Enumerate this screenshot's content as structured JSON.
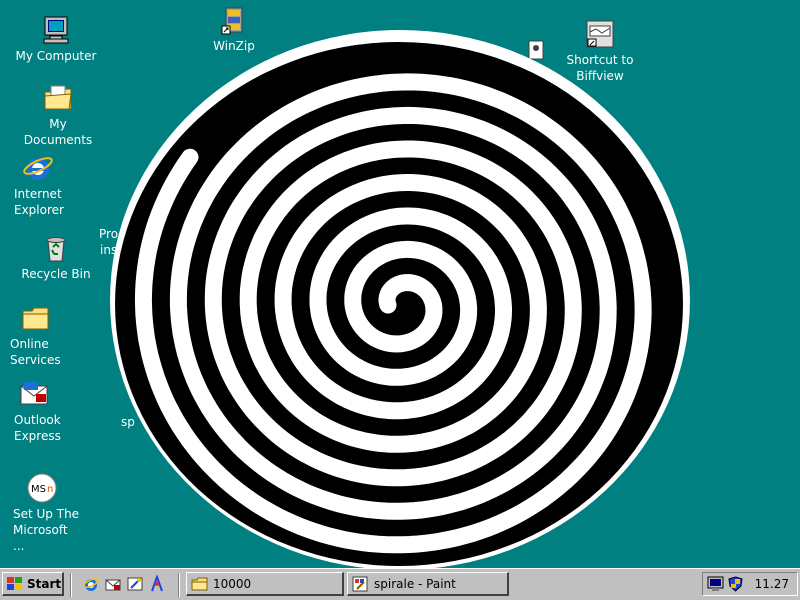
{
  "desktop": {
    "icons": {
      "my_computer": "My Computer",
      "my_documents": "My Documents",
      "internet_explorer": "Internet\nExplorer",
      "recycle_bin": "Recycle Bin",
      "online_services": "Online\nServices",
      "outlook_express": "Outlook\nExpress",
      "setup_msn": "Set Up The\nMicrosoft ...",
      "winzip": "WinZip",
      "shortcut_biffview": "Shortcut to\nBiffview"
    },
    "partial_labels": {
      "programs_fragment_1": "Pro",
      "programs_fragment_2": "ins",
      "spirale_fragment": "sp"
    }
  },
  "taskbar": {
    "start_label": "Start",
    "tasks": [
      {
        "label": "10000"
      },
      {
        "label": "spirale - Paint"
      }
    ],
    "clock": "11.27"
  },
  "icon_names": [
    "computer-icon",
    "documents-folder-icon",
    "ie-icon",
    "recycle-bin-icon",
    "folder-icon",
    "outlook-icon",
    "msn-icon",
    "winzip-icon",
    "biffview-icon",
    "windows-logo-icon",
    "monitor-icon",
    "shield-icon"
  ],
  "colors": {
    "desktop_background": "#008080",
    "taskbar": "#c0c0c0",
    "spiral_black": "#000000",
    "spiral_white": "#ffffff"
  }
}
